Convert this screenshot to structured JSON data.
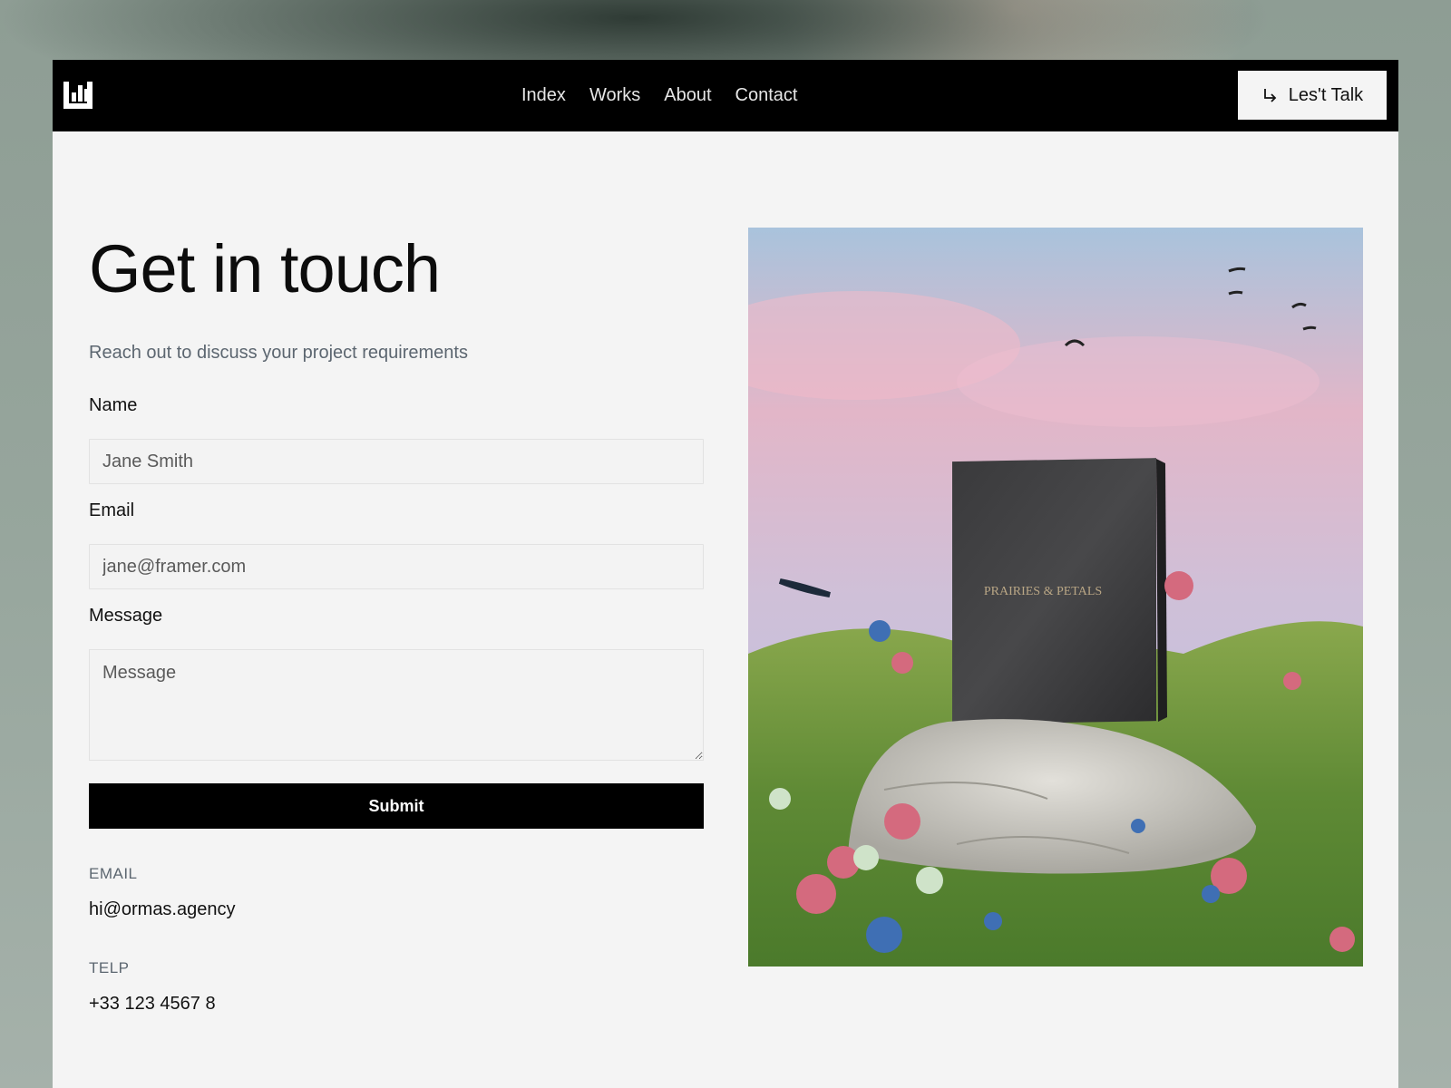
{
  "nav": {
    "links": [
      "Index",
      "Works",
      "About",
      "Contact"
    ],
    "cta_label": "Les't Talk",
    "logo_icon": "bar-chart-logo-icon",
    "cta_icon": "arrow-down-right-icon"
  },
  "contact": {
    "title": "Get in touch",
    "subtitle": "Reach out to discuss your project requirements",
    "form": {
      "name_label": "Name",
      "name_placeholder": "Jane Smith",
      "email_label": "Email",
      "email_placeholder": "jane@framer.com",
      "message_label": "Message",
      "message_placeholder": "Message",
      "submit_label": "Submit"
    },
    "info": {
      "email_label": "EMAIL",
      "email_value": "hi@ormas.agency",
      "phone_label": "TELP",
      "phone_value": "+33 123 4567 8"
    }
  },
  "hero": {
    "box_text": "PRAIRIES & PETALS"
  },
  "colors": {
    "nav_background": "#000000",
    "page_background": "#f4f4f4",
    "button_background": "#000000",
    "muted_text": "#5c6670"
  }
}
